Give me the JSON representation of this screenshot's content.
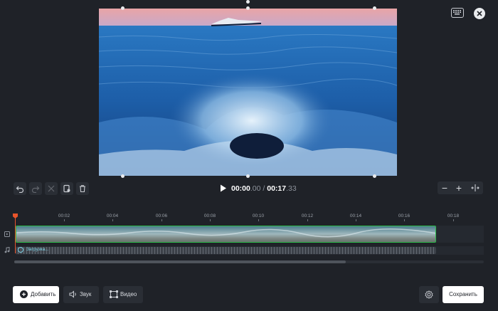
{
  "playback": {
    "current_main": "00:00",
    "current_frac": ".00",
    "separator": " / ",
    "total_main": "00:17",
    "total_frac": ".33"
  },
  "ruler": {
    "ticks": [
      "00:02",
      "00:04",
      "00:06",
      "00:08",
      "00:10",
      "00:12",
      "00:14",
      "00:16",
      "00:18"
    ]
  },
  "timeline": {
    "audio_label": "Загрузка..."
  },
  "bottom": {
    "add_label": "Добавить",
    "sound_label": "Звук",
    "video_label": "Видео",
    "save_label": "Сохранить"
  },
  "zoom": {
    "minus": "−",
    "plus": "+"
  },
  "colors": {
    "background": "#1f2228",
    "panel": "#2a2e35",
    "accent_playhead": "#e8542b",
    "clip_border": "#2dbb4a",
    "audio_text": "#7fd3e6"
  },
  "icons": [
    "keyboard-icon",
    "close-icon",
    "undo-icon",
    "redo-icon",
    "cut-icon",
    "split-icon",
    "trash-icon",
    "play-icon",
    "fit-icon",
    "video-track-icon",
    "music-note-icon",
    "plus-circle-icon",
    "speaker-icon",
    "crop-icon",
    "gear-icon"
  ]
}
